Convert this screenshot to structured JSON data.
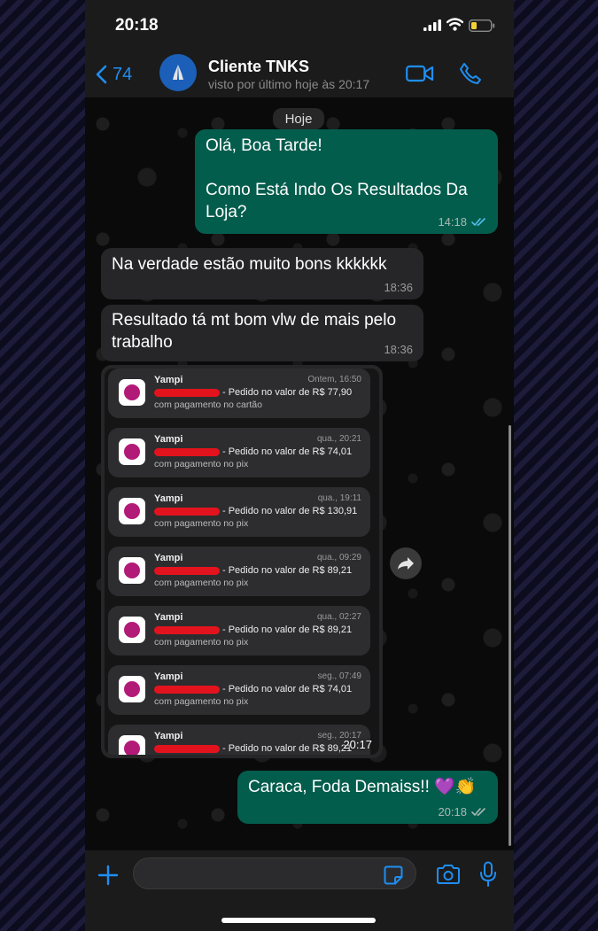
{
  "status_bar": {
    "time": "20:18"
  },
  "header": {
    "back_count": "74",
    "contact_name": "Cliente TNKS",
    "contact_status": "visto por último hoje às 20:17"
  },
  "chat": {
    "date_label": "Hoje",
    "messages": [
      {
        "direction": "outgoing",
        "text": "Olá, Boa Tarde!\n\nComo Está Indo Os Resultados Da Loja?",
        "time": "14:18",
        "status": "read"
      },
      {
        "direction": "incoming",
        "text": "Na verdade estão muito bons kkkkkk",
        "time": "18:36"
      },
      {
        "direction": "incoming",
        "text": "Resultado tá mt bom vlw de mais pelo trabalho",
        "time": "18:36"
      },
      {
        "direction": "incoming",
        "type": "image",
        "time": "20:17"
      },
      {
        "direction": "outgoing",
        "text": "Caraca, Foda Demaiss!! 💜👏",
        "time": "20:18",
        "status": "delivered"
      }
    ],
    "screenshot_notifications": [
      {
        "app": "Yampi",
        "time": "Ontem, 16:50",
        "text": "- Pedido no valor de R$ 77,90",
        "detail": "com pagamento no cartão"
      },
      {
        "app": "Yampi",
        "time": "qua., 20:21",
        "text": "- Pedido no valor de R$ 74,01",
        "detail": "com pagamento no pix"
      },
      {
        "app": "Yampi",
        "time": "qua., 19:11",
        "text": "- Pedido no valor de R$ 130,91",
        "detail": "com pagamento no pix"
      },
      {
        "app": "Yampi",
        "time": "qua., 09:29",
        "text": "- Pedido no valor de R$ 89,21",
        "detail": "com pagamento no pix"
      },
      {
        "app": "Yampi",
        "time": "qua., 02:27",
        "text": "- Pedido no valor de R$ 89,21",
        "detail": "com pagamento no pix"
      },
      {
        "app": "Yampi",
        "time": "seg., 07:49",
        "text": "- Pedido no valor de R$ 74,01",
        "detail": "com pagamento no pix"
      },
      {
        "app": "Yampi",
        "time": "seg., 20:17",
        "text": "- Pedido no valor de R$ 89,21",
        "detail": ""
      }
    ]
  },
  "colors": {
    "accent": "#1f8ef1",
    "outgoing_bubble": "#035d4d",
    "incoming_bubble": "#262628",
    "read_check": "#53bdeb",
    "heart": "#8e44ad"
  },
  "icons": {
    "back": "chevron-left-icon",
    "video": "video-camera-icon",
    "call": "phone-icon",
    "attach": "plus-icon",
    "sticker": "sticker-icon",
    "camera": "camera-icon",
    "mic": "microphone-icon",
    "forward": "forward-arrow-icon"
  }
}
